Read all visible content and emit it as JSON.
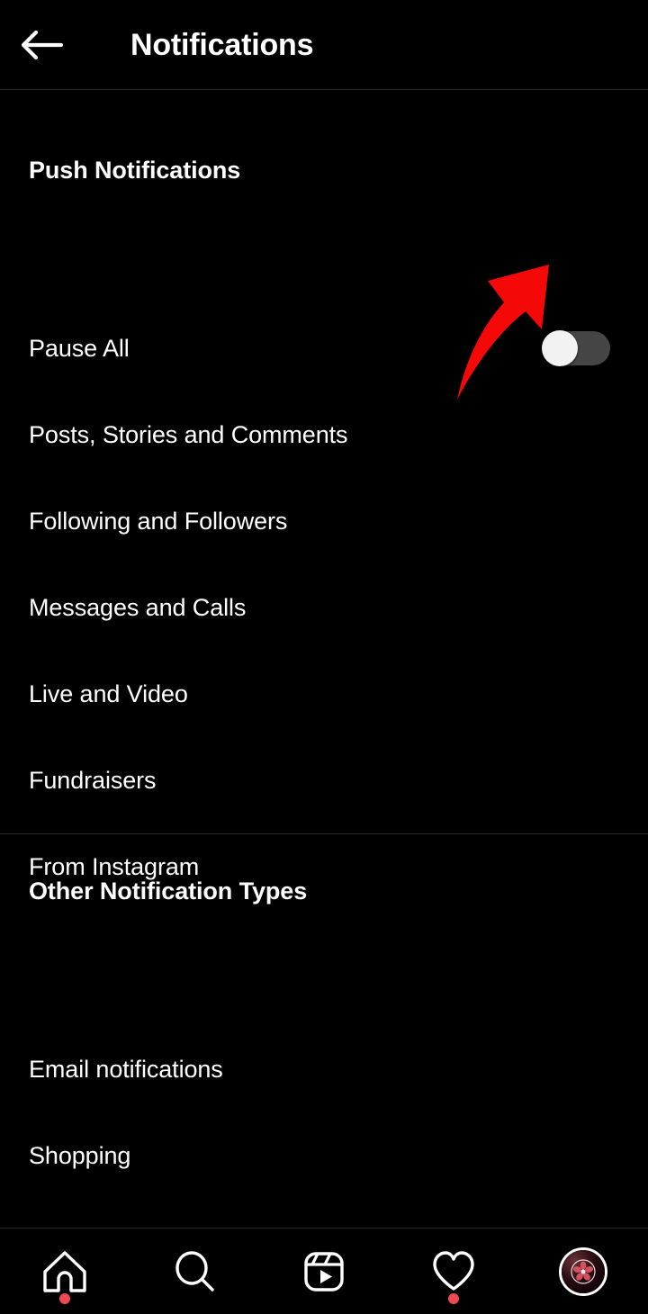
{
  "header": {
    "back_icon": "back-arrow-icon",
    "title": "Notifications"
  },
  "sections": [
    {
      "id": "push-notifications",
      "title": "Push Notifications",
      "items": [
        {
          "label": "Pause All",
          "control": "toggle",
          "toggle_on": false
        },
        {
          "label": "Posts, Stories and Comments",
          "control": "none"
        },
        {
          "label": "Following and Followers",
          "control": "none"
        },
        {
          "label": "Messages and Calls",
          "control": "none"
        },
        {
          "label": "Live and Video",
          "control": "none"
        },
        {
          "label": "Fundraisers",
          "control": "none"
        },
        {
          "label": "From Instagram",
          "control": "none"
        }
      ]
    },
    {
      "id": "other-notification-types",
      "title": "Other Notification Types",
      "items": [
        {
          "label": "Email notifications",
          "control": "none"
        },
        {
          "label": "Shopping",
          "control": "none"
        }
      ]
    }
  ],
  "annotation": {
    "type": "curved-arrow",
    "color": "#f50808",
    "points_to": "pause-all-toggle"
  },
  "bottom_nav": {
    "items": [
      {
        "id": "home",
        "icon": "home-icon",
        "badge_dot": true
      },
      {
        "id": "search",
        "icon": "search-icon",
        "badge_dot": false
      },
      {
        "id": "reels",
        "icon": "reels-icon",
        "badge_dot": false
      },
      {
        "id": "activity",
        "icon": "heart-icon",
        "badge_dot": true
      },
      {
        "id": "profile",
        "icon": "profile-avatar",
        "badge_dot": false
      }
    ]
  },
  "colors": {
    "background": "#000000",
    "text": "#ffffff",
    "divider": "#262626",
    "toggle_track_off": "#454545",
    "toggle_knob": "#f2f2f2",
    "badge_dot": "#ed4956",
    "annotation": "#f50808"
  }
}
